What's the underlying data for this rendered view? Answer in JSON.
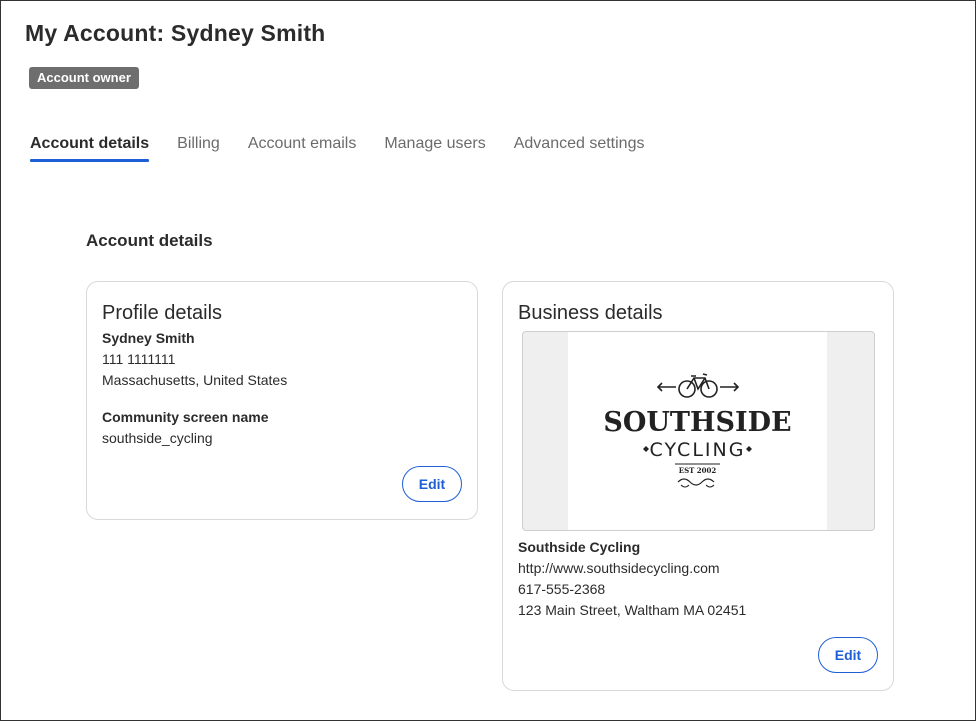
{
  "header": {
    "title": "My Account: Sydney Smith",
    "badge": "Account owner"
  },
  "tabs": [
    {
      "label": "Account details",
      "active": true
    },
    {
      "label": "Billing",
      "active": false
    },
    {
      "label": "Account emails",
      "active": false
    },
    {
      "label": "Manage users",
      "active": false
    },
    {
      "label": "Advanced settings",
      "active": false
    }
  ],
  "section": {
    "heading": "Account details"
  },
  "profile": {
    "title": "Profile details",
    "name": "Sydney Smith",
    "phone": "111 1111111",
    "location": "Massachusetts, United States",
    "screen_name_label": "Community screen name",
    "screen_name": "southside_cycling",
    "edit_label": "Edit"
  },
  "business": {
    "title": "Business details",
    "logo": {
      "line1": "SOUTHSIDE",
      "line2": "CYCLING",
      "est": "EST 2002",
      "icon": "bicycle-icon"
    },
    "name": "Southside Cycling",
    "url": "http://www.southsidecycling.com",
    "phone": "617-555-2368",
    "address": "123 Main Street, Waltham MA 02451",
    "edit_label": "Edit"
  },
  "colors": {
    "accent": "#1f5fd6",
    "badge_bg": "#6e6e6e",
    "text": "#2b2b2b",
    "muted_text": "#6b6b6b",
    "card_border": "#d9d9d9"
  }
}
